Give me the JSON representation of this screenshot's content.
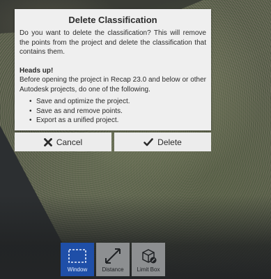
{
  "dialog": {
    "title": "Delete Classification",
    "message": "Do you want to delete the classification? This will remove the points from the project and delete the classification that contains them.",
    "heads_up": "Heads up!",
    "note": "Before opening the project in Recap 23.0 and below or other Autodesk projects, do one of the following.",
    "bullets": [
      "Save and optimize the project.",
      "Save as and remove points.",
      "Export as a unified project."
    ]
  },
  "buttons": {
    "cancel_label": "Cancel",
    "delete_label": "Delete"
  },
  "toolbar": {
    "window_label": "Window",
    "distance_label": "Distance",
    "limit_box_label": "Limit Box"
  },
  "colors": {
    "dialog_bg": "#efefef",
    "active_tool": "#1f4fa8",
    "inactive_tool": "#8d8f91"
  }
}
